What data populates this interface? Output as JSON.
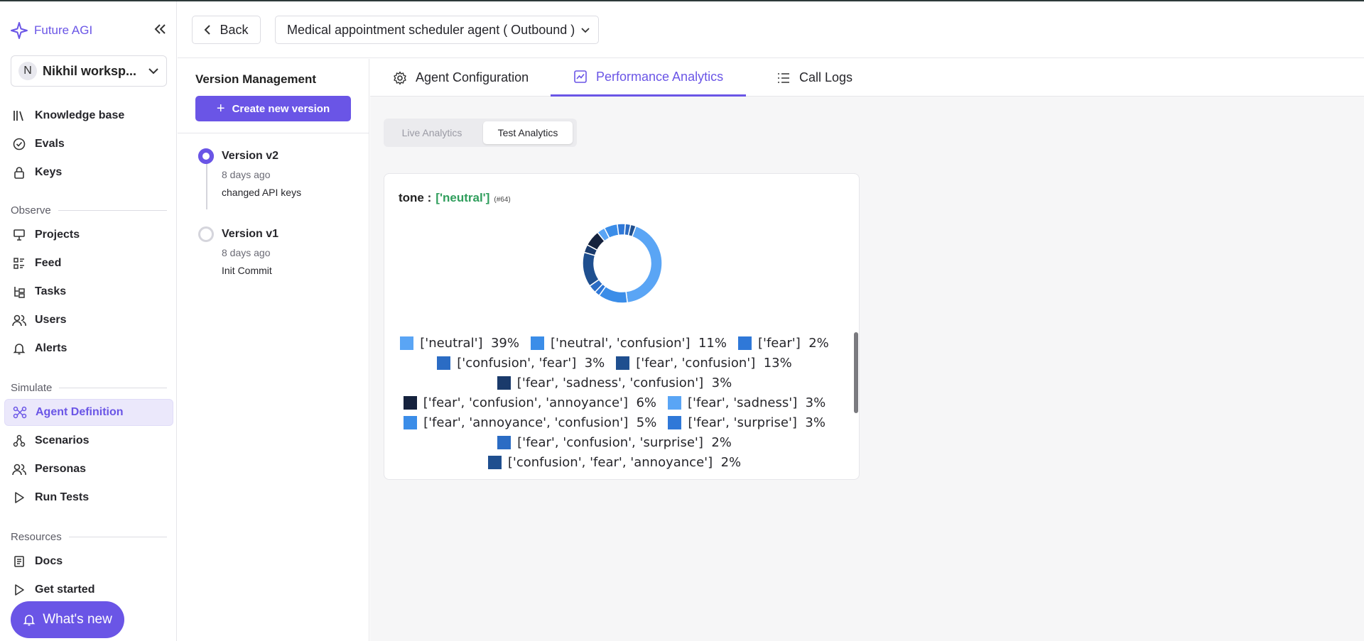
{
  "app": {
    "brand": "Future AGI",
    "workspace": {
      "avatar_letter": "N",
      "name": "Nikhil worksp..."
    }
  },
  "sidebar": {
    "top_items": [
      {
        "label": "Knowledge base",
        "icon": "library-icon"
      },
      {
        "label": "Evals",
        "icon": "check-circle-icon"
      },
      {
        "label": "Keys",
        "icon": "lock-icon"
      }
    ],
    "sections": {
      "observe": "Observe",
      "simulate": "Simulate",
      "resources": "Resources"
    },
    "observe_items": [
      {
        "label": "Projects",
        "icon": "presentation-icon"
      },
      {
        "label": "Feed",
        "icon": "feed-icon"
      },
      {
        "label": "Tasks",
        "icon": "tasks-icon"
      },
      {
        "label": "Users",
        "icon": "users-icon"
      },
      {
        "label": "Alerts",
        "icon": "bell-icon"
      }
    ],
    "simulate_items": [
      {
        "label": "Agent Definition",
        "icon": "agent-icon",
        "active": true
      },
      {
        "label": "Scenarios",
        "icon": "scenarios-icon"
      },
      {
        "label": "Personas",
        "icon": "personas-icon"
      },
      {
        "label": "Run Tests",
        "icon": "play-icon"
      }
    ],
    "resources_items": [
      {
        "label": "Docs",
        "icon": "docs-icon"
      },
      {
        "label": "Get started",
        "icon": "play-icon"
      }
    ],
    "whats_new": "What's new"
  },
  "header": {
    "back_label": "Back",
    "agent_name": "Medical appointment scheduler agent ( Outbound )"
  },
  "versions": {
    "title": "Version Management",
    "create_label": "Create new version",
    "items": [
      {
        "name": "Version v2",
        "date": "8 days ago",
        "message": "changed API keys",
        "active": true
      },
      {
        "name": "Version v1",
        "date": "8 days ago",
        "message": "Init Commit",
        "active": false
      }
    ]
  },
  "tabs": [
    {
      "label": "Agent Configuration",
      "icon": "gear-icon"
    },
    {
      "label": "Performance Analytics",
      "icon": "chart-icon",
      "active": true
    },
    {
      "label": "Call Logs",
      "icon": "list-icon"
    }
  ],
  "analytics_toggle": {
    "live": "Live Analytics",
    "test": "Test Analytics",
    "selected": "test"
  },
  "card": {
    "key": "tone :",
    "value": "['neutral']",
    "count": "(#64)"
  },
  "chart_data": {
    "type": "pie",
    "title": "tone : ['neutral']",
    "legend_position": "bottom",
    "slices": [
      {
        "label": "['neutral']",
        "percent": 39,
        "color": "#5aa5f5"
      },
      {
        "label": "['neutral', 'confusion']",
        "percent": 11,
        "color": "#3b8de8"
      },
      {
        "label": "['fear']",
        "percent": 2,
        "color": "#2f78d8"
      },
      {
        "label": "['confusion', 'fear']",
        "percent": 3,
        "color": "#2b6cc4"
      },
      {
        "label": "['fear', 'confusion']",
        "percent": 13,
        "color": "#1f4f8f"
      },
      {
        "label": "['fear', 'sadness', 'confusion']",
        "percent": 3,
        "color": "#1a3a6b"
      },
      {
        "label": "['fear', 'confusion', 'annoyance']",
        "percent": 6,
        "color": "#15223d"
      },
      {
        "label": "['fear', 'sadness']",
        "percent": 3,
        "color": "#5aa5f5"
      },
      {
        "label": "['fear', 'annoyance', 'confusion']",
        "percent": 5,
        "color": "#3b8de8"
      },
      {
        "label": "['fear', 'surprise']",
        "percent": 3,
        "color": "#2f78d8"
      },
      {
        "label": "['fear', 'confusion', 'surprise']",
        "percent": 2,
        "color": "#2b6cc4"
      },
      {
        "label": "['confusion', 'fear', 'annoyance']",
        "percent": 2,
        "color": "#1f4f8f"
      }
    ]
  }
}
